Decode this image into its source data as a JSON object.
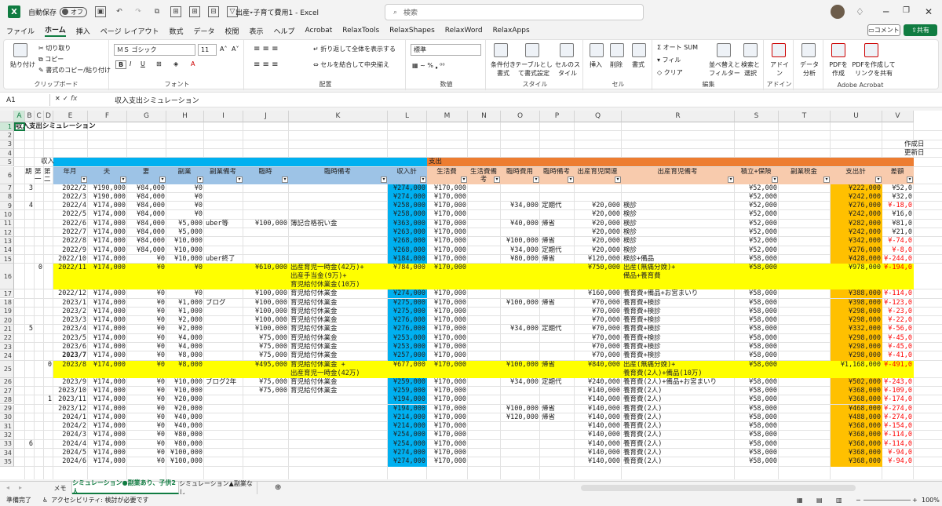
{
  "titlebar": {
    "autosave_label": "自動保存",
    "autosave_state": "オフ",
    "doc_title": "出産･子育て費用1 - Excel",
    "search_placeholder": "検索"
  },
  "menu": [
    "ファイル",
    "ホーム",
    "挿入",
    "ページ レイアウト",
    "数式",
    "データ",
    "校閲",
    "表示",
    "ヘルプ",
    "Acrobat",
    "RelaxTools",
    "RelaxShapes",
    "RelaxWord",
    "RelaxApps"
  ],
  "menu_active": "ホーム",
  "comment_label": "コメント",
  "share_label": "共有",
  "ribbon": {
    "clipboard": {
      "paste": "貼り付け",
      "cut": "切り取り",
      "copy": "コピー",
      "format_painter": "書式のコピー/貼り付け",
      "label": "クリップボード"
    },
    "font": {
      "name": "ＭＳ ゴシック",
      "size": "11",
      "label": "フォント"
    },
    "alignment": {
      "wrap": "折り返して全体を表示する",
      "merge": "セルを結合して中央揃え",
      "label": "配置"
    },
    "number": {
      "format": "標準",
      "label": "数値"
    },
    "styles": {
      "cond": "条件付き書式",
      "table": "テーブルとして書式設定",
      "cell": "セルのスタイル",
      "label": "スタイル"
    },
    "cells": {
      "insert": "挿入",
      "delete": "削除",
      "format": "書式",
      "label": "セル"
    },
    "editing": {
      "autosum": "オート SUM",
      "fill": "フィル",
      "clear": "クリア",
      "sort": "並べ替えとフィルター",
      "find": "検索と選択",
      "label": "編集"
    },
    "addin": {
      "addin": "アドイン",
      "label": "アドイン"
    },
    "analysis": {
      "data": "データ分析"
    },
    "acrobat": {
      "pdf": "PDFを作成",
      "pdf_share": "PDFを作成してリンクを共有",
      "label": "Adobe Acrobat"
    }
  },
  "formula_bar": {
    "cell_ref": "A1",
    "fx": "fx",
    "content": "収入支出シミュレーション"
  },
  "columns": [
    "A",
    "B",
    "C",
    "D",
    "E",
    "F",
    "G",
    "H",
    "I",
    "J",
    "K",
    "L",
    "M",
    "N",
    "O",
    "P",
    "Q",
    "R",
    "S",
    "T",
    "U",
    "V"
  ],
  "sheet": {
    "title": "収入支出シミュレーション",
    "created_label": "作成日",
    "updated_label": "更新日",
    "income_section": "収入",
    "expense_section": "支出",
    "headers": {
      "B": "期",
      "C": "第一",
      "D": "第二",
      "E": "年月",
      "F": "夫",
      "G": "妻",
      "H": "副業",
      "I": "副業備考",
      "J": "臨時",
      "K": "臨時備考",
      "L": "収入計",
      "M": "生活費",
      "N": "生活費備考",
      "O": "臨時費用",
      "P": "臨時備考",
      "Q": "出産育児関連",
      "R": "出産育児備考",
      "S": "積立+保険",
      "T": "副業税金",
      "U": "支出計",
      "V": "差額"
    },
    "rows": [
      {
        "n": "7",
        "B": "3",
        "E": "2022/2",
        "F": "¥190,000",
        "G": "¥84,000",
        "H": "¥0",
        "L": "¥274,000",
        "M": "¥170,000",
        "Q": "",
        "S": "¥52,000",
        "U": "¥222,000",
        "V": "¥52,0"
      },
      {
        "n": "8",
        "E": "2022/3",
        "F": "¥190,000",
        "G": "¥84,000",
        "H": "¥0",
        "L": "¥274,000",
        "M": "¥170,000",
        "S": "¥52,000",
        "U": "¥242,000",
        "V": "¥32,0"
      },
      {
        "n": "9",
        "B": "4",
        "E": "2022/4",
        "F": "¥174,000",
        "G": "¥84,000",
        "H": "¥0",
        "L": "¥258,000",
        "M": "¥170,000",
        "O": "¥34,000",
        "P": "定期代",
        "Q": "¥20,000",
        "R": "検診",
        "S": "¥52,000",
        "U": "¥276,000",
        "V": "¥-18,0"
      },
      {
        "n": "10",
        "E": "2022/5",
        "F": "¥174,000",
        "G": "¥84,000",
        "H": "¥0",
        "L": "¥258,000",
        "M": "¥170,000",
        "Q": "¥20,000",
        "R": "検診",
        "S": "¥52,000",
        "U": "¥242,000",
        "V": "¥16,0"
      },
      {
        "n": "11",
        "E": "2022/6",
        "F": "¥174,000",
        "G": "¥84,000",
        "H": "¥5,000",
        "I": "uber等",
        "J": "¥100,000",
        "K": "簿記合格祝い金",
        "L": "¥363,000",
        "M": "¥170,000",
        "O": "¥40,000",
        "P": "帰省",
        "Q": "¥20,000",
        "R": "検診",
        "S": "¥52,000",
        "U": "¥282,000",
        "V": "¥81,0"
      },
      {
        "n": "12",
        "E": "2022/7",
        "F": "¥174,000",
        "G": "¥84,000",
        "H": "¥5,000",
        "L": "¥263,000",
        "M": "¥170,000",
        "Q": "¥20,000",
        "R": "検診",
        "S": "¥52,000",
        "U": "¥242,000",
        "V": "¥21,0"
      },
      {
        "n": "13",
        "E": "2022/8",
        "F": "¥174,000",
        "G": "¥84,000",
        "H": "¥10,000",
        "L": "¥268,000",
        "M": "¥170,000",
        "O": "¥100,000",
        "P": "帰省",
        "Q": "¥20,000",
        "R": "検診",
        "S": "¥52,000",
        "U": "¥342,000",
        "V": "¥-74,0"
      },
      {
        "n": "14",
        "E": "2022/9",
        "F": "¥174,000",
        "G": "¥84,000",
        "H": "¥10,000",
        "L": "¥268,000",
        "M": "¥170,000",
        "O": "¥34,000",
        "P": "定期代",
        "Q": "¥20,000",
        "R": "検診",
        "S": "¥52,000",
        "U": "¥276,000",
        "V": "¥-8,0"
      },
      {
        "n": "15",
        "E": "2022/10",
        "F": "¥174,000",
        "G": "¥0",
        "H": "¥10,000",
        "I": "uber終了",
        "L": "¥184,000",
        "M": "¥170,000",
        "O": "¥80,000",
        "P": "帰省",
        "Q": "¥120,000",
        "R": "検診+備品",
        "S": "¥58,000",
        "U": "¥428,000",
        "V": "¥-244,0"
      },
      {
        "n": "16",
        "C": "0",
        "E": "2022/11",
        "F": "¥174,000",
        "G": "¥0",
        "H": "¥0",
        "J": "¥610,000",
        "K": "出産育児一時金(42万)+\n出産手当金(9万)+\n育児給付休業金(10万)",
        "L": "¥784,000",
        "M": "¥170,000",
        "Q": "¥750,000",
        "R": "出産(無痛分娩)+\n備品+養育費",
        "S": "¥58,000",
        "U": "¥978,000",
        "V": "¥-194,0",
        "hl": true
      },
      {
        "n": "17",
        "E": "2022/12",
        "F": "¥174,000",
        "G": "¥0",
        "H": "¥0",
        "J": "¥100,000",
        "K": "育児給付休業金",
        "L": "¥274,000",
        "M": "¥170,000",
        "Q": "¥160,000",
        "R": "養育費+備品+お宮まいり",
        "S": "¥58,000",
        "U": "¥388,000",
        "V": "¥-114,0"
      },
      {
        "n": "18",
        "E": "2023/1",
        "F": "¥174,000",
        "G": "¥0",
        "H": "¥1,000",
        "I": "ブログ",
        "J": "¥100,000",
        "K": "育児給付休業金",
        "L": "¥275,000",
        "M": "¥170,000",
        "O": "¥100,000",
        "P": "帰省",
        "Q": "¥70,000",
        "R": "養育費+検診",
        "S": "¥58,000",
        "U": "¥398,000",
        "V": "¥-123,0"
      },
      {
        "n": "19",
        "E": "2023/2",
        "F": "¥174,000",
        "G": "¥0",
        "H": "¥1,000",
        "J": "¥100,000",
        "K": "育児給付休業金",
        "L": "¥275,000",
        "M": "¥170,000",
        "Q": "¥70,000",
        "R": "養育費+検診",
        "S": "¥58,000",
        "U": "¥298,000",
        "V": "¥-23,0"
      },
      {
        "n": "20",
        "E": "2023/3",
        "F": "¥174,000",
        "G": "¥0",
        "H": "¥2,000",
        "J": "¥100,000",
        "K": "育児給付休業金",
        "L": "¥276,000",
        "M": "¥170,000",
        "Q": "¥70,000",
        "R": "養育費+検診",
        "S": "¥58,000",
        "U": "¥298,000",
        "V": "¥-22,0"
      },
      {
        "n": "21",
        "B": "5",
        "E": "2023/4",
        "F": "¥174,000",
        "G": "¥0",
        "H": "¥2,000",
        "J": "¥100,000",
        "K": "育児給付休業金",
        "L": "¥276,000",
        "M": "¥170,000",
        "O": "¥34,000",
        "P": "定期代",
        "Q": "¥70,000",
        "R": "養育費+検診",
        "S": "¥58,000",
        "U": "¥332,000",
        "V": "¥-56,0"
      },
      {
        "n": "22",
        "E": "2023/5",
        "F": "¥174,000",
        "G": "¥0",
        "H": "¥4,000",
        "J": "¥75,000",
        "K": "育児給付休業金",
        "L": "¥253,000",
        "M": "¥170,000",
        "Q": "¥70,000",
        "R": "養育費+検診",
        "S": "¥58,000",
        "U": "¥298,000",
        "V": "¥-45,0"
      },
      {
        "n": "23",
        "E": "2023/6",
        "F": "¥174,000",
        "G": "¥0",
        "H": "¥4,000",
        "J": "¥75,000",
        "K": "育児給付休業金",
        "L": "¥253,000",
        "M": "¥170,000",
        "Q": "¥70,000",
        "R": "養育費+検診",
        "S": "¥58,000",
        "U": "¥298,000",
        "V": "¥-45,0"
      },
      {
        "n": "24",
        "E": "2023/7",
        "F": "¥174,000",
        "G": "¥0",
        "H": "¥8,000",
        "J": "¥75,000",
        "K": "育児給付休業金",
        "L": "¥257,000",
        "M": "¥170,000",
        "Q": "¥70,000",
        "R": "養育費+検診",
        "S": "¥58,000",
        "U": "¥298,000",
        "V": "¥-41,0",
        "boldE": true
      },
      {
        "n": "25",
        "D": "0",
        "E": "2023/8",
        "F": "¥174,000",
        "G": "¥0",
        "H": "¥8,000",
        "J": "¥495,000",
        "K": "育児給付休業金 +\n出産育児一時金(42万)",
        "L": "¥677,000",
        "M": "¥170,000",
        "O": "¥100,000",
        "P": "帰省",
        "Q": "¥840,000",
        "R": "出産(無痛分娩)+\n養育費(2人)+備品(10万)",
        "S": "¥58,000",
        "U": "¥1,168,000",
        "V": "¥-491,0",
        "hl": true
      },
      {
        "n": "26",
        "E": "2023/9",
        "F": "¥174,000",
        "G": "¥0",
        "H": "¥10,000",
        "I": "ブログ2年",
        "J": "¥75,000",
        "K": "育児給付休業金",
        "L": "¥259,000",
        "M": "¥170,000",
        "O": "¥34,000",
        "P": "定期代",
        "Q": "¥240,000",
        "R": "養育費(2人)+備品+お宮まいり",
        "S": "¥58,000",
        "U": "¥502,000",
        "V": "¥-243,0"
      },
      {
        "n": "27",
        "E": "2023/10",
        "F": "¥174,000",
        "G": "¥0",
        "H": "¥10,000",
        "J": "¥75,000",
        "K": "育児給付休業金",
        "L": "¥259,000",
        "M": "¥170,000",
        "Q": "¥140,000",
        "R": "養育費(2人)",
        "S": "¥58,000",
        "U": "¥368,000",
        "V": "¥-109,0"
      },
      {
        "n": "28",
        "D": "1",
        "E": "2023/11",
        "F": "¥174,000",
        "G": "¥0",
        "H": "¥20,000",
        "L": "¥194,000",
        "M": "¥170,000",
        "Q": "¥140,000",
        "R": "養育費(2人)",
        "S": "¥58,000",
        "U": "¥368,000",
        "V": "¥-174,0"
      },
      {
        "n": "29",
        "E": "2023/12",
        "F": "¥174,000",
        "G": "¥0",
        "H": "¥20,000",
        "L": "¥194,000",
        "M": "¥170,000",
        "O": "¥100,000",
        "P": "帰省",
        "Q": "¥140,000",
        "R": "養育費(2人)",
        "S": "¥58,000",
        "U": "¥468,000",
        "V": "¥-274,0"
      },
      {
        "n": "30",
        "E": "2024/1",
        "F": "¥174,000",
        "G": "¥0",
        "H": "¥40,000",
        "L": "¥214,000",
        "M": "¥170,000",
        "O": "¥120,000",
        "P": "帰省",
        "Q": "¥140,000",
        "R": "養育費(2人)",
        "S": "¥58,000",
        "U": "¥488,000",
        "V": "¥-274,0"
      },
      {
        "n": "31",
        "E": "2024/2",
        "F": "¥174,000",
        "G": "¥0",
        "H": "¥40,000",
        "L": "¥214,000",
        "M": "¥170,000",
        "Q": "¥140,000",
        "R": "養育費(2人)",
        "S": "¥58,000",
        "U": "¥368,000",
        "V": "¥-154,0"
      },
      {
        "n": "32",
        "E": "2024/3",
        "F": "¥174,000",
        "G": "¥0",
        "H": "¥80,000",
        "L": "¥254,000",
        "M": "¥170,000",
        "Q": "¥140,000",
        "R": "養育費(2人)",
        "S": "¥58,000",
        "U": "¥368,000",
        "V": "¥-114,0"
      },
      {
        "n": "33",
        "B": "6",
        "E": "2024/4",
        "F": "¥174,000",
        "G": "¥0",
        "H": "¥80,000",
        "L": "¥254,000",
        "M": "¥170,000",
        "Q": "¥140,000",
        "R": "養育費(2人)",
        "S": "¥58,000",
        "U": "¥368,000",
        "V": "¥-114,0"
      },
      {
        "n": "34",
        "E": "2024/5",
        "F": "¥174,000",
        "G": "¥0",
        "H": "¥100,000",
        "L": "¥274,000",
        "M": "¥170,000",
        "Q": "¥140,000",
        "R": "養育費(2人)",
        "S": "¥58,000",
        "U": "¥368,000",
        "V": "¥-94,0"
      },
      {
        "n": "35",
        "E": "2024/6",
        "F": "¥174,000",
        "G": "¥0",
        "H": "¥100,000",
        "L": "¥274,000",
        "M": "¥170,000",
        "Q": "¥140,000",
        "R": "養育費(2人)",
        "S": "¥58,000",
        "U": "¥368,000",
        "V": "¥-94,0"
      }
    ]
  },
  "tabs": [
    "メモ",
    "シミュレーション●副業あり、子供2人",
    "シミュレーション▲副業なし"
  ],
  "tab_active": 1,
  "status": {
    "ready": "準備完了",
    "accessibility": "アクセシビリティ: 検討が必要です",
    "zoom": "100%"
  },
  "colors": {
    "income_header": "#00b0f0",
    "expense_header": "#ed7d31",
    "col_header_blue": "#9dc3e6",
    "col_header_orange": "#f8cbad",
    "income_total": "#00b0f0",
    "expense_total": "#ffc000",
    "highlight": "#ffff00",
    "negative": "#ff0000"
  }
}
